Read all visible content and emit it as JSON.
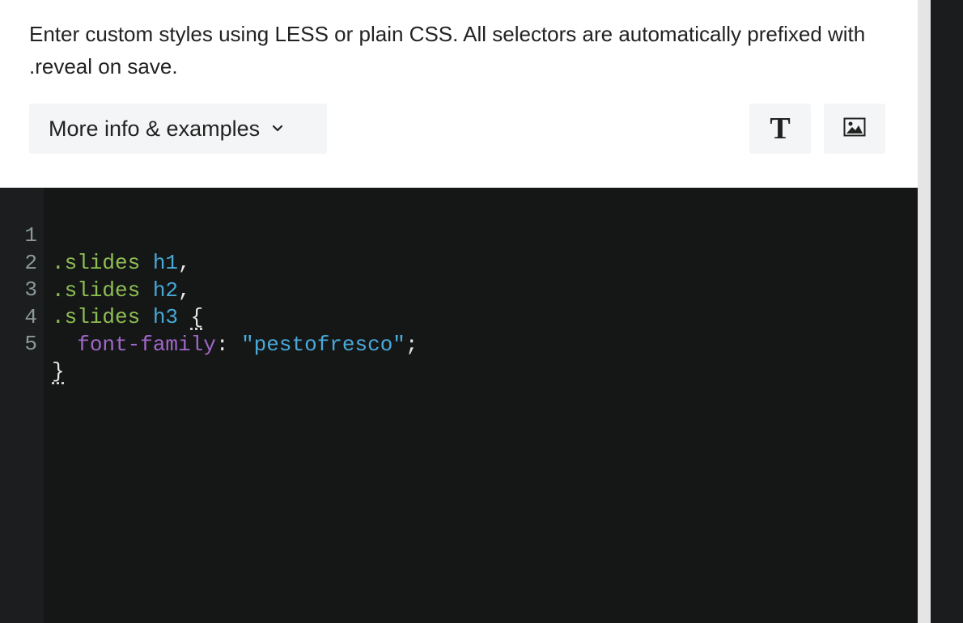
{
  "description": "Enter custom styles using LESS or plain CSS. All selectors are automatically prefixed with .reveal on save.",
  "more_info_label": "More info & examples",
  "toolbar": {
    "text_glyph": "T",
    "text_icon": "text-style-icon",
    "image_icon": "image-icon"
  },
  "editor": {
    "line_numbers": [
      "1",
      "2",
      "3",
      "4",
      "5"
    ],
    "lines": [
      {
        "indent": "",
        "selector": ".slides",
        "space": " ",
        "tag": "h1",
        "punct": ","
      },
      {
        "indent": "",
        "selector": ".slides",
        "space": " ",
        "tag": "h2",
        "punct": ","
      },
      {
        "indent": "",
        "selector": ".slides",
        "space": " ",
        "tag": "h3",
        "punct": " ",
        "brace": "{"
      },
      {
        "indent": "  ",
        "property": "font-family",
        "colon": ": ",
        "string": "\"pestofresco\"",
        "semicolon": ";"
      },
      {
        "brace": "}"
      }
    ]
  },
  "colors": {
    "selector": "#8fbe54",
    "tag": "#47a8d6",
    "property": "#a167c9",
    "string": "#49a9d9",
    "editor_bg": "#151717",
    "button_bg": "#f4f5f6"
  }
}
